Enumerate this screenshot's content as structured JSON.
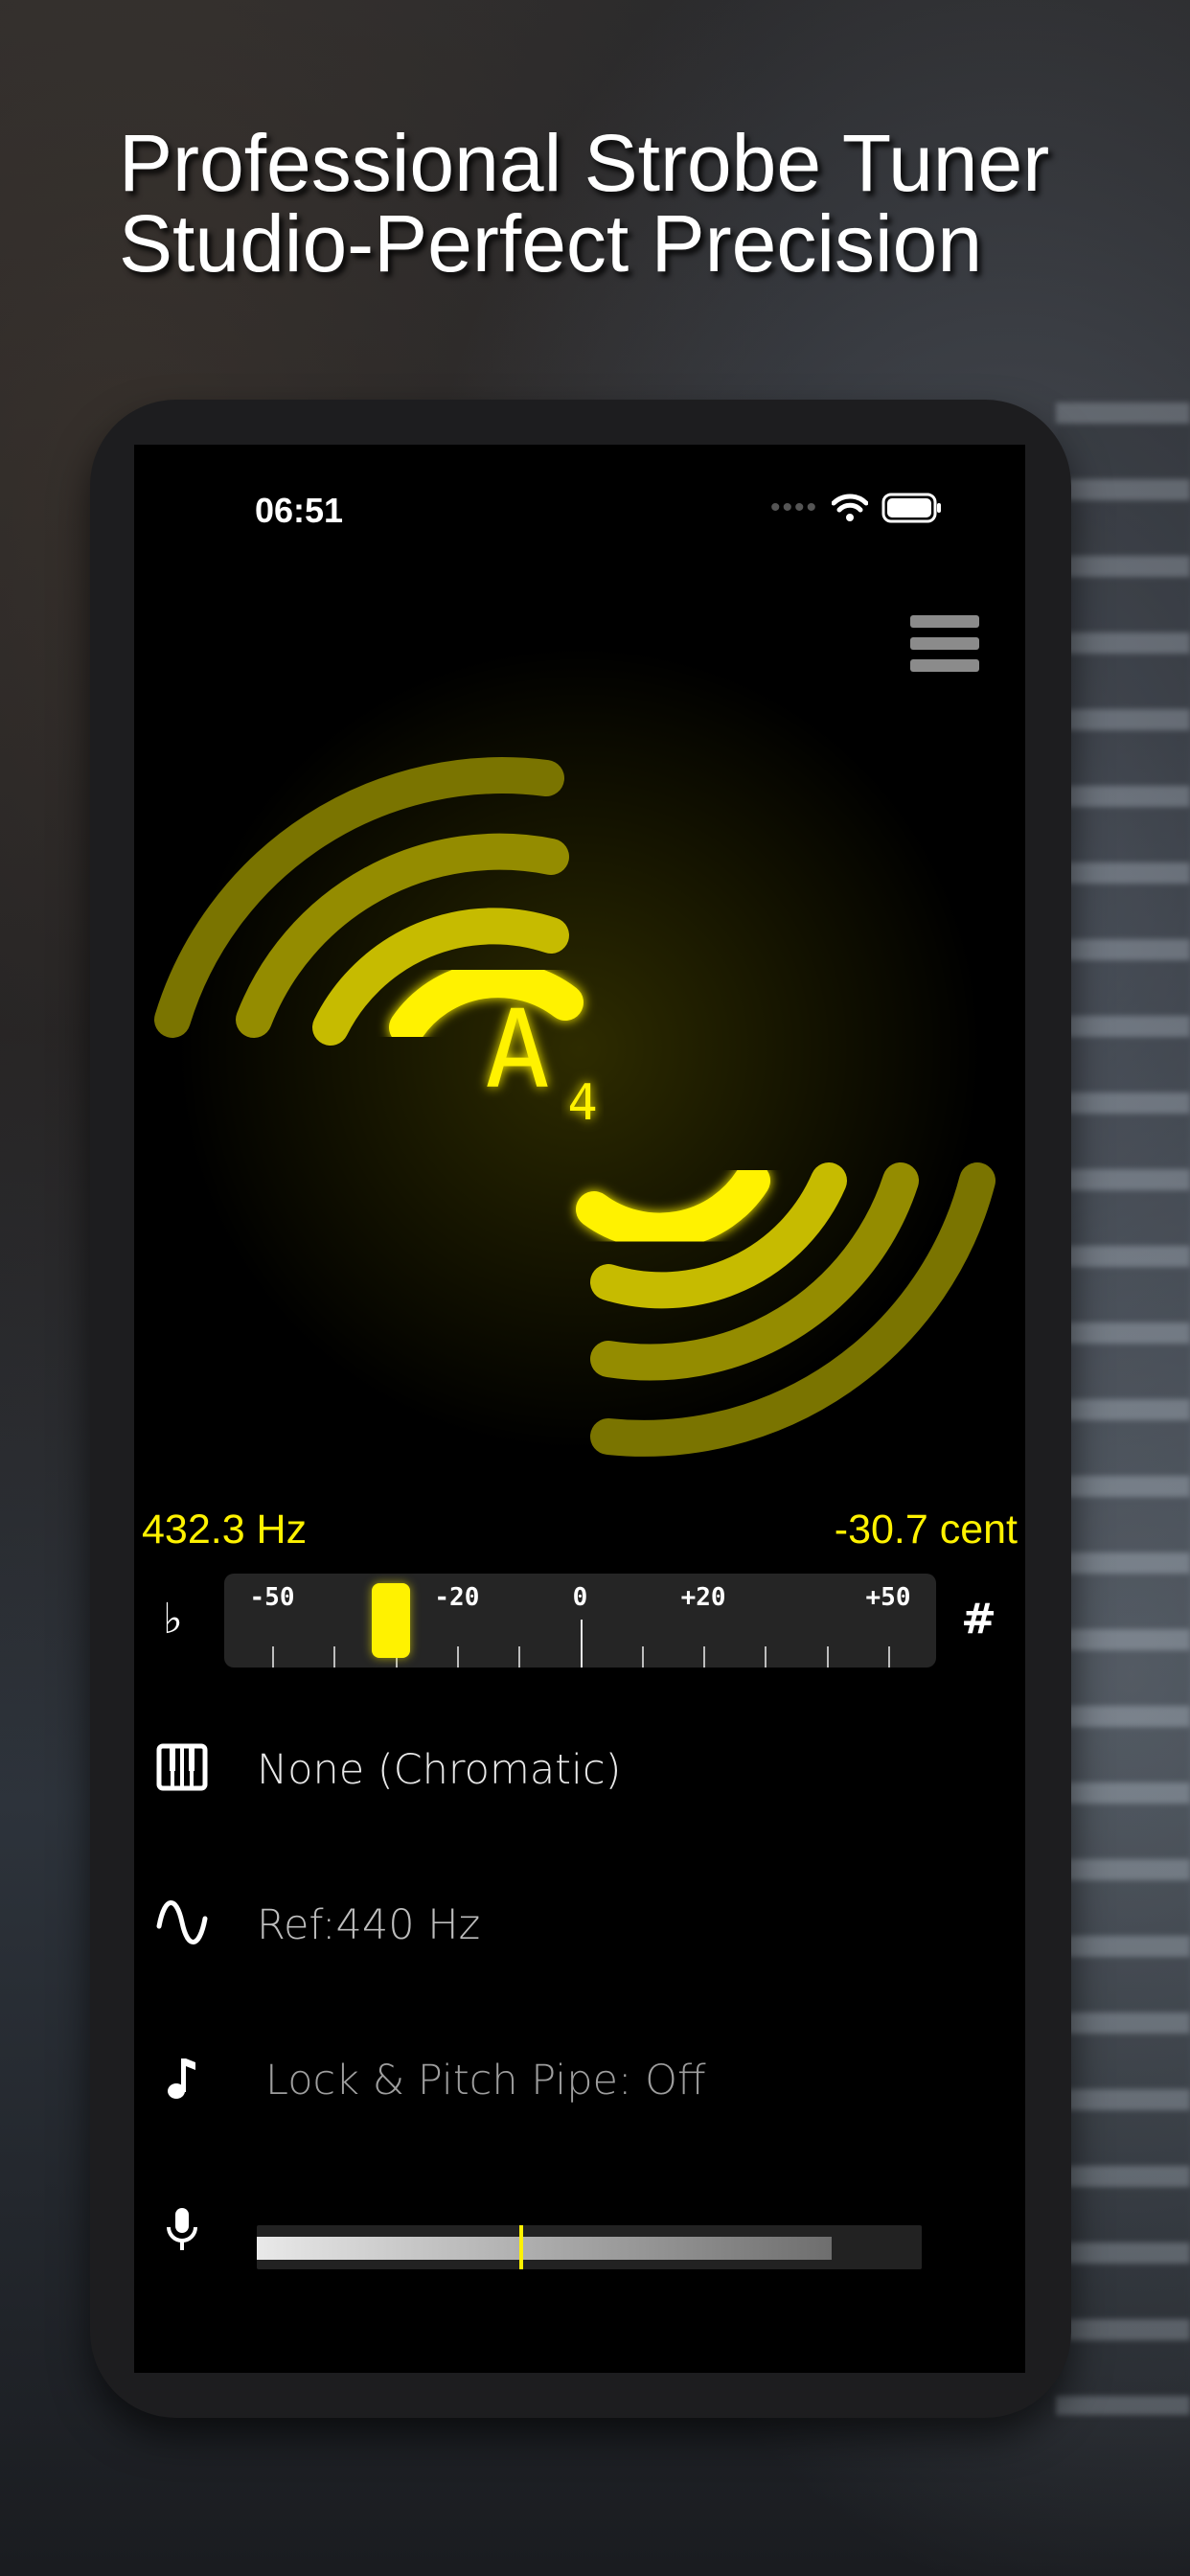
{
  "headline": {
    "line1": "Professional Strobe Tuner",
    "line2": "Studio-Perfect Precision"
  },
  "status_bar": {
    "time": "06:51"
  },
  "tuner": {
    "note_letter": "A",
    "note_octave": "4",
    "frequency_text": "432.3 Hz",
    "cents_text": "-30.7 cent",
    "cents_value": -30.7,
    "meter": {
      "flat_symbol": "♭",
      "sharp_symbol": "#",
      "scale_labels": [
        "-50",
        "-20",
        "0",
        "+20",
        "+50"
      ]
    }
  },
  "settings": {
    "temperament_label": "None (Chromatic)",
    "reference_label": "Ref:440 Hz",
    "lock_label": "Lock & Pitch Pipe: Off"
  },
  "input_level": {
    "level_fraction": 0.865,
    "threshold_fraction": 0.395
  },
  "colors": {
    "accent": "#fff200",
    "background": "#000000"
  },
  "icons": [
    "menu-icon",
    "piano-keys-icon",
    "sine-wave-icon",
    "music-note-icon",
    "microphone-icon",
    "wifi-icon",
    "battery-icon"
  ]
}
